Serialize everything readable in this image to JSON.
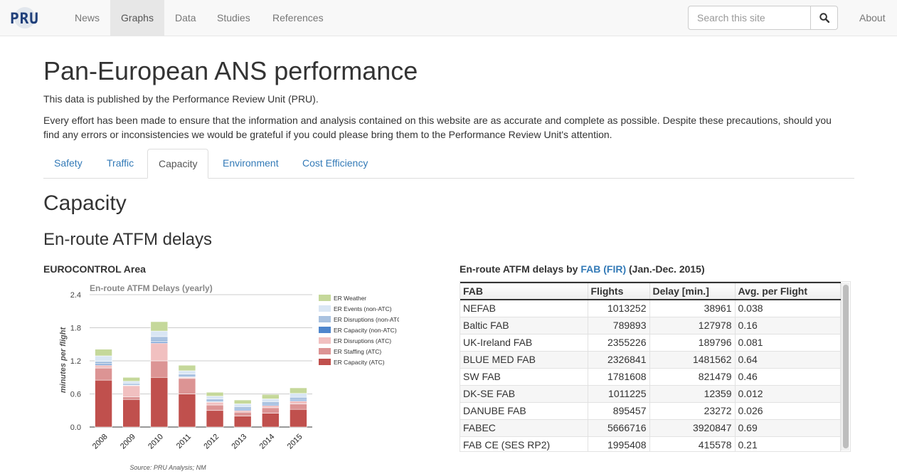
{
  "navbar": {
    "logo_text": "PRU",
    "items": [
      {
        "label": "News",
        "active": false
      },
      {
        "label": "Graphs",
        "active": true
      },
      {
        "label": "Data",
        "active": false
      },
      {
        "label": "Studies",
        "active": false
      },
      {
        "label": "References",
        "active": false
      }
    ],
    "search_placeholder": "Search this site",
    "about_label": "About"
  },
  "page": {
    "title": "Pan-European ANS performance",
    "intro": "This data is published by the Performance Review Unit (PRU).",
    "disclaimer_line1": "Every effort has been made to ensure that the information and analysis contained on this website are as accurate and complete as possible. Despite these precautions, should you",
    "disclaimer_line2": "find any errors or inconsistencies we would be grateful if you could please bring them to the Performance Review Unit's attention."
  },
  "tabs": [
    {
      "label": "Safety",
      "active": false
    },
    {
      "label": "Traffic",
      "active": false
    },
    {
      "label": "Capacity",
      "active": true
    },
    {
      "label": "Environment",
      "active": false
    },
    {
      "label": "Cost Efficiency",
      "active": false
    }
  ],
  "section": {
    "title": "Capacity",
    "subtitle": "En-route ATFM delays",
    "chart_heading": "EUROCONTROL Area",
    "table_heading_prefix": "En-route ATFM delays by ",
    "table_heading_link": "FAB (FIR)",
    "table_heading_suffix": " (Jan.-Dec. 2015)"
  },
  "colors": {
    "link": "#337ab7",
    "ER Weather": "#c5d89a",
    "ER Events (non-ATC)": "#d9e6f4",
    "ER Disruptions (non-ATC)": "#a9c2e0",
    "ER Capacity (non-ATC)": "#4f86cc",
    "ER Disruptions (ATC)": "#f1c0c0",
    "ER Staffing (ATC)": "#dc9494",
    "ER Capacity (ATC)": "#c0504d"
  },
  "chart_data": {
    "type": "bar",
    "stacked": true,
    "title": "En-route ATFM Delays (yearly)",
    "ylabel": "minutes per flight",
    "xlabel": "",
    "source": "Source: PRU Analysis; NM",
    "ylim": [
      0,
      2.4
    ],
    "yticks": [
      "0.0",
      "0.6",
      "1.2",
      "1.8",
      "2.4"
    ],
    "grid": true,
    "legend_position": "right",
    "categories": [
      "2008",
      "2009",
      "2010",
      "2011",
      "2012",
      "2013",
      "2014",
      "2015"
    ],
    "series": [
      {
        "name": "ER Capacity (ATC)",
        "values": [
          0.85,
          0.5,
          0.9,
          0.6,
          0.3,
          0.2,
          0.25,
          0.32
        ]
      },
      {
        "name": "ER Staffing (ATC)",
        "values": [
          0.22,
          0.05,
          0.3,
          0.28,
          0.1,
          0.07,
          0.1,
          0.1
        ]
      },
      {
        "name": "ER Disruptions (ATC)",
        "values": [
          0.05,
          0.2,
          0.32,
          0.02,
          0.05,
          0.03,
          0.04,
          0.05
        ]
      },
      {
        "name": "ER Capacity (non-ATC)",
        "values": [
          0.02,
          0.01,
          0.02,
          0.01,
          0.01,
          0.02,
          0.02,
          0.02
        ]
      },
      {
        "name": "ER Disruptions (non-ATC)",
        "values": [
          0.05,
          0.03,
          0.1,
          0.05,
          0.05,
          0.05,
          0.05,
          0.05
        ]
      },
      {
        "name": "ER Events (non-ATC)",
        "values": [
          0.1,
          0.04,
          0.1,
          0.06,
          0.05,
          0.05,
          0.05,
          0.07
        ]
      },
      {
        "name": "ER Weather",
        "values": [
          0.12,
          0.07,
          0.17,
          0.1,
          0.07,
          0.07,
          0.08,
          0.1
        ]
      }
    ]
  },
  "fab_table": {
    "headers": [
      "FAB",
      "Flights",
      "Delay [min.]",
      "Avg. per Flight"
    ],
    "rows": [
      [
        "NEFAB",
        "1013252",
        "38961",
        "0.038"
      ],
      [
        "Baltic FAB",
        "789893",
        "127978",
        "0.16"
      ],
      [
        "UK-Ireland FAB",
        "2355226",
        "189796",
        "0.081"
      ],
      [
        "BLUE MED FAB",
        "2326841",
        "1481562",
        "0.64"
      ],
      [
        "SW FAB",
        "1781608",
        "821479",
        "0.46"
      ],
      [
        "DK-SE FAB",
        "1011225",
        "12359",
        "0.012"
      ],
      [
        "DANUBE FAB",
        "895457",
        "23272",
        "0.026"
      ],
      [
        "FABEC",
        "5666716",
        "3920847",
        "0.69"
      ],
      [
        "FAB CE (SES RP2)",
        "1995408",
        "415578",
        "0.21"
      ]
    ]
  }
}
